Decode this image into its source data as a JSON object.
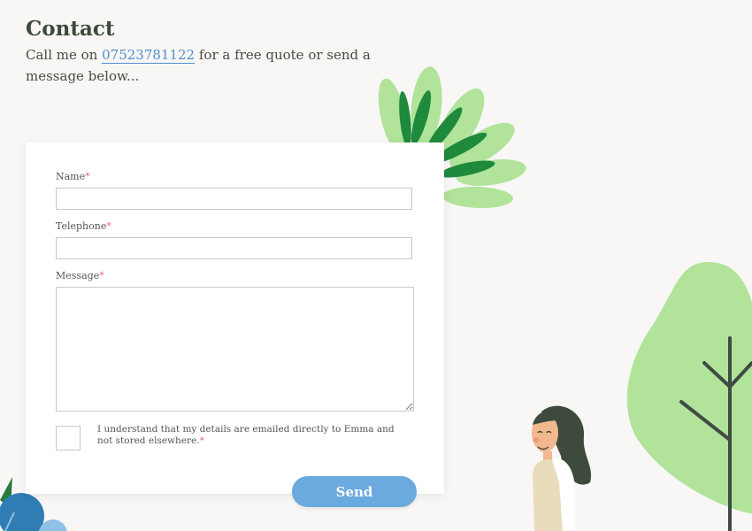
{
  "header": {
    "title": "Contact",
    "intro_before": "Call me on ",
    "phone": "07523781122",
    "intro_after": " for a free quote or send a message below..."
  },
  "form": {
    "name_label": "Name",
    "telephone_label": "Telephone",
    "message_label": "Message",
    "required_marker": "*",
    "name_value": "",
    "telephone_value": "",
    "message_value": "",
    "consent_text": "I understand that my details are emailed directly to Emma and not stored elsewhere.",
    "consent_checked": false,
    "send_label": "Send"
  },
  "colors": {
    "background": "#f8f7f5",
    "accent": "#6aaade",
    "link": "#4e8fd0",
    "required": "#e56b6b",
    "leaf_light": "#b1e39b",
    "leaf_dark": "#1f8a3c"
  },
  "icons": {
    "plant": "leafy-plant-illustration",
    "tree": "tree-illustration",
    "person": "woman-illustration",
    "bush": "bush-illustration"
  }
}
